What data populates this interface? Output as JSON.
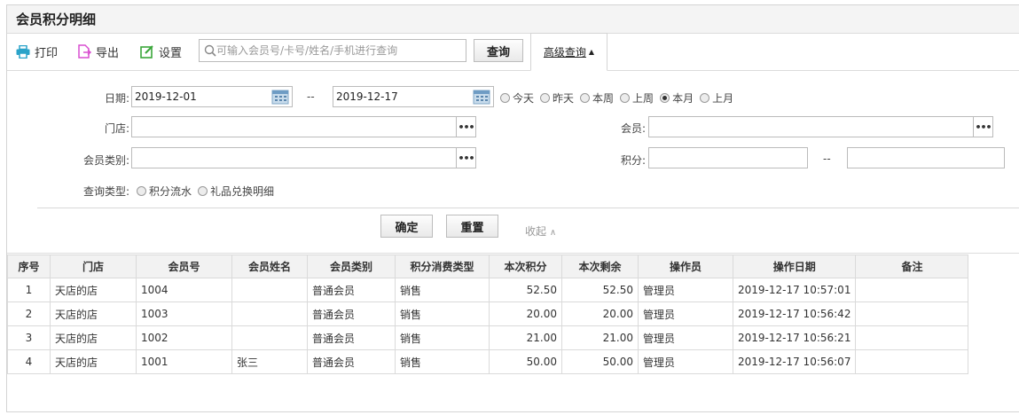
{
  "page": {
    "title": "会员积分明细"
  },
  "toolbar": {
    "print": "打印",
    "export": "导出",
    "settings": "设置",
    "search_placeholder": "可输入会员号/卡号/姓名/手机进行查询",
    "query": "查询",
    "advanced": "高级查询"
  },
  "filters": {
    "date_label": "日期:",
    "date_from": "2019-12-01",
    "date_sep": "--",
    "date_to": "2019-12-17",
    "date_options": [
      {
        "label": "今天",
        "selected": false
      },
      {
        "label": "昨天",
        "selected": false
      },
      {
        "label": "本周",
        "selected": false
      },
      {
        "label": "上周",
        "selected": false
      },
      {
        "label": "本月",
        "selected": true
      },
      {
        "label": "上月",
        "selected": false
      }
    ],
    "store_label": "门店:",
    "store_value": "",
    "member_label": "会员:",
    "member_value": "",
    "member_type_label": "会员类别:",
    "member_type_value": "",
    "points_label": "积分:",
    "points_from": "",
    "points_sep": "--",
    "points_to": "",
    "query_type_label": "查询类型:",
    "query_type_options": [
      {
        "label": "积分流水",
        "selected": false
      },
      {
        "label": "礼品兑换明细",
        "selected": false
      }
    ],
    "confirm": "确定",
    "reset": "重置",
    "collapse": "收起"
  },
  "table": {
    "columns": [
      "序号",
      "门店",
      "会员号",
      "会员姓名",
      "会员类别",
      "积分消费类型",
      "本次积分",
      "本次剩余",
      "操作员",
      "操作日期",
      "备注"
    ],
    "rows": [
      [
        "1",
        "天店的店",
        "1004",
        "",
        "普通会员",
        "销售",
        "52.50",
        "52.50",
        "管理员",
        "2019-12-17 10:57:01",
        ""
      ],
      [
        "2",
        "天店的店",
        "1003",
        "",
        "普通会员",
        "销售",
        "20.00",
        "20.00",
        "管理员",
        "2019-12-17 10:56:42",
        ""
      ],
      [
        "3",
        "天店的店",
        "1002",
        "",
        "普通会员",
        "销售",
        "21.00",
        "21.00",
        "管理员",
        "2019-12-17 10:56:21",
        ""
      ],
      [
        "4",
        "天店的店",
        "1001",
        "张三",
        "普通会员",
        "销售",
        "50.00",
        "50.00",
        "管理员",
        "2019-12-17 10:56:07",
        ""
      ]
    ]
  },
  "colors": {
    "accent": "#2aa3c9",
    "export_icon": "#d94fd0",
    "settings_icon": "#3aa63a"
  }
}
